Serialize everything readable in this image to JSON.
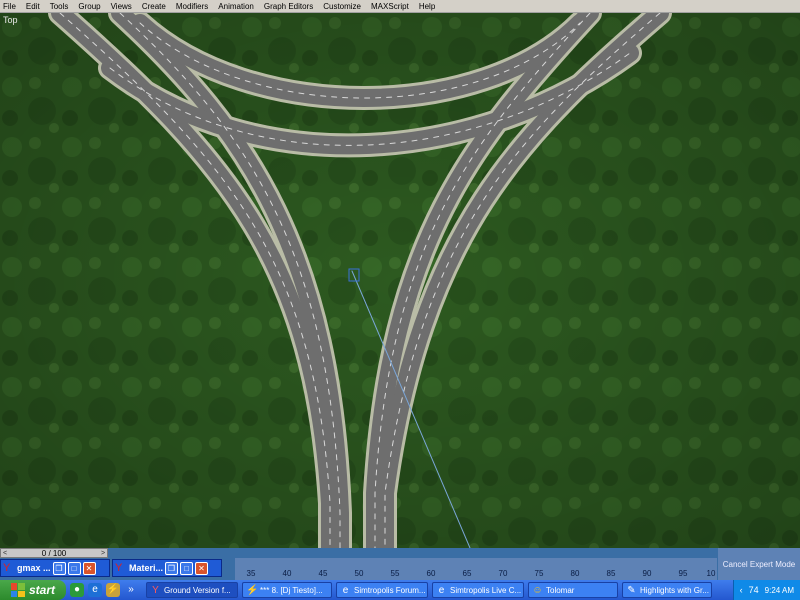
{
  "menu": [
    "File",
    "Edit",
    "Tools",
    "Group",
    "Views",
    "Create",
    "Modifiers",
    "Animation",
    "Graph Editors",
    "Customize",
    "MAXScript",
    "Help"
  ],
  "viewport": {
    "label": "Top"
  },
  "time_slider": {
    "value": "0 / 100",
    "prev": "<",
    ">": ">",
    "next": ">"
  },
  "ruler": {
    "ticks": [
      "35",
      "40",
      "45",
      "50",
      "55",
      "60",
      "65",
      "70",
      "75",
      "80",
      "85",
      "90",
      "95",
      "10"
    ]
  },
  "expert_mode": "Cancel Expert Mode",
  "mini_windows": [
    {
      "title": "gmax ..."
    },
    {
      "title": "Materi..."
    }
  ],
  "taskbar": {
    "start_label": "start",
    "more": "»",
    "tasks": [
      {
        "label": "Ground Version f...",
        "icon": "gmax-icon"
      },
      {
        "label": "*** 8. [Dj Tiesto]...",
        "icon": "winamp-icon"
      },
      {
        "label": "Simtropolis Forum...",
        "icon": "ie-icon"
      },
      {
        "label": "Simtropolis Live C...",
        "icon": "ie-icon"
      },
      {
        "label": "Tolomar",
        "icon": "user-icon"
      },
      {
        "label": "Highlights with Gr...",
        "icon": "paint-icon"
      }
    ],
    "tray_lang": "74",
    "clock": "9:24 AM"
  }
}
